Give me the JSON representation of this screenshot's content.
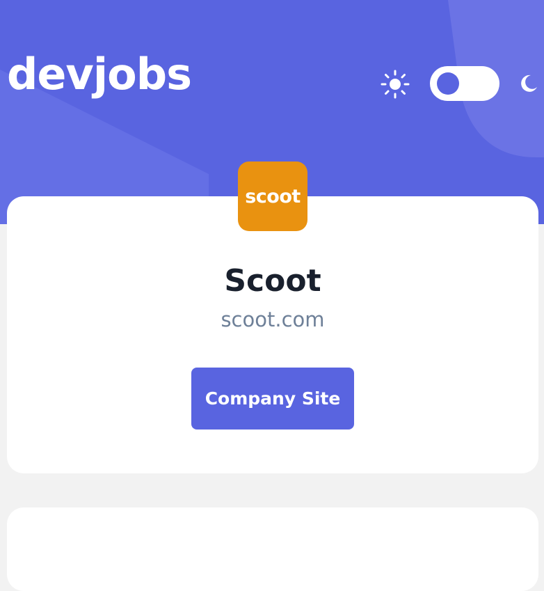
{
  "header": {
    "logo_text": "devjobs",
    "background_color": "#5964e0",
    "theme_toggle": {
      "light_icon": "sun-icon",
      "dark_icon": "moon-icon",
      "mode": "light"
    }
  },
  "company": {
    "logo_text": "scoot",
    "logo_color": "#e99210",
    "name": "Scoot",
    "website": "scoot.com",
    "site_button_label": "Company Site"
  },
  "colors": {
    "accent": "#5964e0",
    "page_background": "#f2f2f2",
    "card_background": "#ffffff",
    "title_text": "#19202d",
    "muted_text": "#6e8098"
  }
}
